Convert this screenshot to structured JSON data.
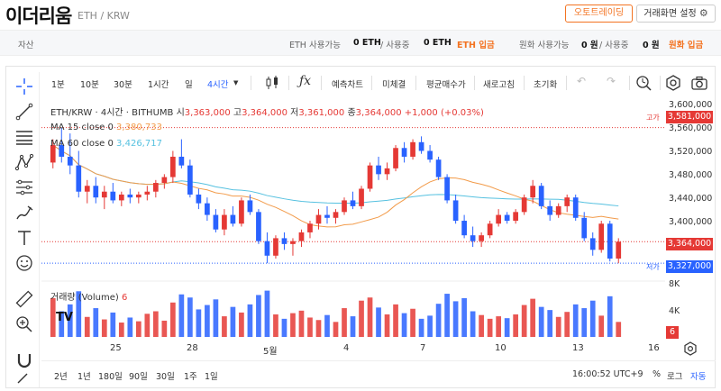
{
  "header": {
    "coin_name": "이더리움",
    "pair": "ETH / KRW",
    "auto_trade_label": "오토트레이딩",
    "settings_label": "거래화면 설정"
  },
  "asset_bar": {
    "label": "자산",
    "eth_available_label": "ETH 사용가능",
    "eth_available_value": "0 ETH",
    "eth_in_use_label": "/ 사용중",
    "eth_in_use_value": "0 ETH",
    "eth_deposit_label": "ETH 입금",
    "krw_available_label": "원화 사용가능",
    "krw_available_value": "0 원",
    "krw_in_use_label": "/ 사용중",
    "krw_in_use_value": "0 원",
    "krw_deposit_label": "원화 입금"
  },
  "toolbar": {
    "intervals": [
      "1분",
      "10분",
      "30분",
      "1시간",
      "일",
      "4시간"
    ],
    "active_interval": "4시간",
    "buttons": [
      "예측차트",
      "미체결",
      "평균매수가",
      "새로고침",
      "초기화"
    ]
  },
  "legend": {
    "symbol": "ETH/KRW · 4시간 · BITHUMB",
    "open_label": "시",
    "open": "3,363,000",
    "high_label": "고",
    "high": "3,364,000",
    "low_label": "저",
    "low": "3,361,000",
    "close_label": "종",
    "close": "3,364,000",
    "change": "+1,000 (+0.03%)",
    "ma15_label": "MA 15 close 0",
    "ma15_value": "3,380,733",
    "ma60_label": "MA 60 close 0",
    "ma60_value": "3,426,717"
  },
  "price_axis": {
    "labels": [
      "3,600,000",
      "3,560,000",
      "3,520,000",
      "3,480,000",
      "3,440,000",
      "3,400,000"
    ],
    "high_tag": "3,581,000",
    "high_label": "고가",
    "current_tag": "3,364,000",
    "low_tag": "3,327,000",
    "low_label": "저가"
  },
  "volume": {
    "label": "거래량 (Volume)",
    "value": "6",
    "axis_labels": [
      "8K",
      "4K"
    ],
    "tag": "6"
  },
  "x_axis": [
    "25",
    "28",
    "5월",
    "4",
    "7",
    "10",
    "13",
    "16"
  ],
  "bottom_bar": {
    "ranges": [
      "2년",
      "1년",
      "180일",
      "90일",
      "30일",
      "1주",
      "1일"
    ],
    "time": "16:00:52 UTC+9",
    "percent": "%",
    "log": "로그",
    "auto": "자동"
  },
  "colors": {
    "up": "#e53935",
    "down": "#2962ff",
    "ma15": "#f29b4a",
    "ma60": "#56c1e0",
    "accent": "#f37321"
  },
  "chart_data": {
    "type": "candlestick",
    "interval": "4시간",
    "ohlc": [
      [
        3500000,
        3540000,
        3490000,
        3530000
      ],
      [
        3530000,
        3560000,
        3500000,
        3510000
      ],
      [
        3510000,
        3550000,
        3480000,
        3495000
      ],
      [
        3495000,
        3520000,
        3440000,
        3450000
      ],
      [
        3450000,
        3470000,
        3430000,
        3460000
      ],
      [
        3460000,
        3475000,
        3430000,
        3440000
      ],
      [
        3440000,
        3460000,
        3420000,
        3450000
      ],
      [
        3450000,
        3465000,
        3430000,
        3435000
      ],
      [
        3435000,
        3450000,
        3425000,
        3445000
      ],
      [
        3445000,
        3455000,
        3430000,
        3440000
      ],
      [
        3440000,
        3450000,
        3430000,
        3445000
      ],
      [
        3445000,
        3460000,
        3435000,
        3450000
      ],
      [
        3450000,
        3470000,
        3440000,
        3465000
      ],
      [
        3465000,
        3480000,
        3455000,
        3475000
      ],
      [
        3475000,
        3520000,
        3465000,
        3510000
      ],
      [
        3510000,
        3540000,
        3490000,
        3495000
      ],
      [
        3495000,
        3505000,
        3440000,
        3445000
      ],
      [
        3445000,
        3455000,
        3420000,
        3430000
      ],
      [
        3430000,
        3440000,
        3400000,
        3410000
      ],
      [
        3410000,
        3420000,
        3380000,
        3385000
      ],
      [
        3385000,
        3420000,
        3375000,
        3410000
      ],
      [
        3410000,
        3425000,
        3390000,
        3395000
      ],
      [
        3395000,
        3440000,
        3390000,
        3435000
      ],
      [
        3435000,
        3445000,
        3410000,
        3415000
      ],
      [
        3415000,
        3420000,
        3360000,
        3365000
      ],
      [
        3365000,
        3380000,
        3327000,
        3340000
      ],
      [
        3340000,
        3375000,
        3335000,
        3370000
      ],
      [
        3370000,
        3380000,
        3350000,
        3360000
      ],
      [
        3360000,
        3370000,
        3340000,
        3365000
      ],
      [
        3365000,
        3385000,
        3355000,
        3380000
      ],
      [
        3380000,
        3400000,
        3370000,
        3395000
      ],
      [
        3395000,
        3420000,
        3385000,
        3410000
      ],
      [
        3410000,
        3425000,
        3395000,
        3405000
      ],
      [
        3405000,
        3420000,
        3395000,
        3415000
      ],
      [
        3415000,
        3440000,
        3410000,
        3435000
      ],
      [
        3435000,
        3450000,
        3420000,
        3425000
      ],
      [
        3425000,
        3460000,
        3420000,
        3455000
      ],
      [
        3455000,
        3500000,
        3450000,
        3495000
      ],
      [
        3495000,
        3510000,
        3470000,
        3480000
      ],
      [
        3480000,
        3500000,
        3470000,
        3490000
      ],
      [
        3490000,
        3530000,
        3485000,
        3525000
      ],
      [
        3525000,
        3535000,
        3500000,
        3510000
      ],
      [
        3510000,
        3540000,
        3505000,
        3535000
      ],
      [
        3535000,
        3545000,
        3515000,
        3520000
      ],
      [
        3520000,
        3530000,
        3500000,
        3505000
      ],
      [
        3505000,
        3510000,
        3470000,
        3475000
      ],
      [
        3475000,
        3480000,
        3430000,
        3435000
      ],
      [
        3435000,
        3445000,
        3395000,
        3400000
      ],
      [
        3400000,
        3410000,
        3370000,
        3375000
      ],
      [
        3375000,
        3390000,
        3355000,
        3365000
      ],
      [
        3365000,
        3380000,
        3355000,
        3375000
      ],
      [
        3375000,
        3400000,
        3370000,
        3395000
      ],
      [
        3395000,
        3420000,
        3390000,
        3410000
      ],
      [
        3410000,
        3415000,
        3395000,
        3400000
      ],
      [
        3400000,
        3420000,
        3395000,
        3415000
      ],
      [
        3415000,
        3445000,
        3410000,
        3440000
      ],
      [
        3440000,
        3470000,
        3430000,
        3460000
      ],
      [
        3460000,
        3465000,
        3420000,
        3425000
      ],
      [
        3425000,
        3435000,
        3400000,
        3410000
      ],
      [
        3410000,
        3430000,
        3405000,
        3425000
      ],
      [
        3425000,
        3445000,
        3415000,
        3440000
      ],
      [
        3440000,
        3445000,
        3400000,
        3405000
      ],
      [
        3405000,
        3415000,
        3365000,
        3370000
      ],
      [
        3370000,
        3380000,
        3340000,
        3350000
      ],
      [
        3350000,
        3400000,
        3345000,
        3395000
      ],
      [
        3395000,
        3400000,
        3330000,
        3335000
      ],
      [
        3335000,
        3370000,
        3327000,
        3364000
      ]
    ],
    "volume": [
      6200,
      4100,
      5200,
      7300,
      3200,
      4600,
      2800,
      3900,
      2300,
      3100,
      2500,
      3700,
      4100,
      2600,
      5500,
      6800,
      6300,
      4400,
      5100,
      6000,
      3300,
      4800,
      3900,
      5200,
      6700,
      7400,
      3600,
      2900,
      3800,
      4200,
      3100,
      2700,
      3500,
      2400,
      4600,
      3300,
      5800,
      6300,
      4700,
      3600,
      5200,
      3800,
      4500,
      2900,
      3400,
      5300,
      6900,
      5700,
      6200,
      4100,
      3500,
      2900,
      3300,
      3000,
      3600,
      5100,
      6100,
      4800,
      4300,
      3200,
      4000,
      5200,
      4600,
      5800,
      3400,
      6500,
      2400
    ]
  }
}
